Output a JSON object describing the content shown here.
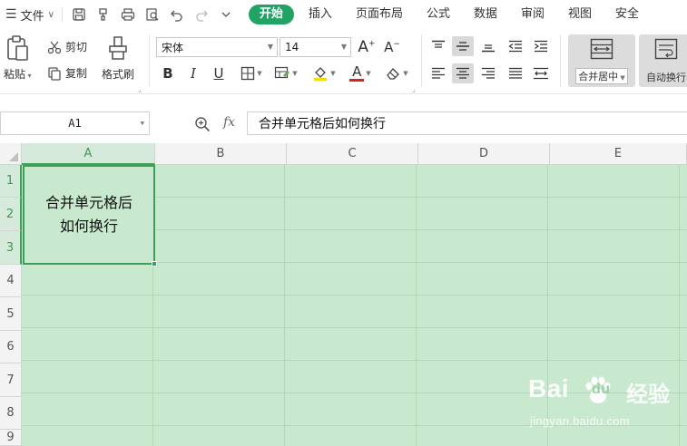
{
  "menu": {
    "file_label": "文件",
    "tabs": [
      {
        "label": "开始",
        "active": true
      },
      {
        "label": "插入",
        "active": false
      },
      {
        "label": "页面布局",
        "active": false
      },
      {
        "label": "公式",
        "active": false
      },
      {
        "label": "数据",
        "active": false
      },
      {
        "label": "审阅",
        "active": false
      },
      {
        "label": "视图",
        "active": false
      },
      {
        "label": "安全",
        "active": false
      }
    ],
    "quick_access_icons": [
      "save-icon",
      "format-painter-icon",
      "print-icon",
      "print-preview-icon",
      "undo-icon",
      "redo-icon",
      "customize-icon"
    ]
  },
  "ribbon": {
    "paste_label": "粘贴",
    "cut_label": "剪切",
    "copy_label": "复制",
    "format_painter_label": "格式刷",
    "font_name": "宋体",
    "font_size": "14",
    "bold": "B",
    "italic": "I",
    "underline": "U",
    "font_color_glyph": "A",
    "merge_label": "合并居中",
    "wrap_label": "自动换行",
    "highlight_color": "#f5d90a",
    "font_color": "#e02020"
  },
  "formula_bar": {
    "name_box": "A1",
    "fx_label": "fx",
    "content": "合并单元格后如何换行"
  },
  "sheet": {
    "columns": [
      "A",
      "B",
      "C",
      "D",
      "E"
    ],
    "rows": [
      "1",
      "2",
      "3",
      "4",
      "5",
      "6",
      "7",
      "8",
      "9"
    ],
    "selected_column": "A",
    "merged_cell": {
      "range": "A1:A3",
      "line1": "合并单元格后",
      "line2": "如何换行"
    },
    "cell_fill_color": "#c9e9cf",
    "selection_color": "#3e9f5a"
  },
  "watermark": {
    "brand": "Bai",
    "brand_suffix": "du",
    "brand_cn": "经验",
    "url": "jingyan.baidu.com"
  },
  "colors": {
    "active_tab": "#21a366"
  }
}
